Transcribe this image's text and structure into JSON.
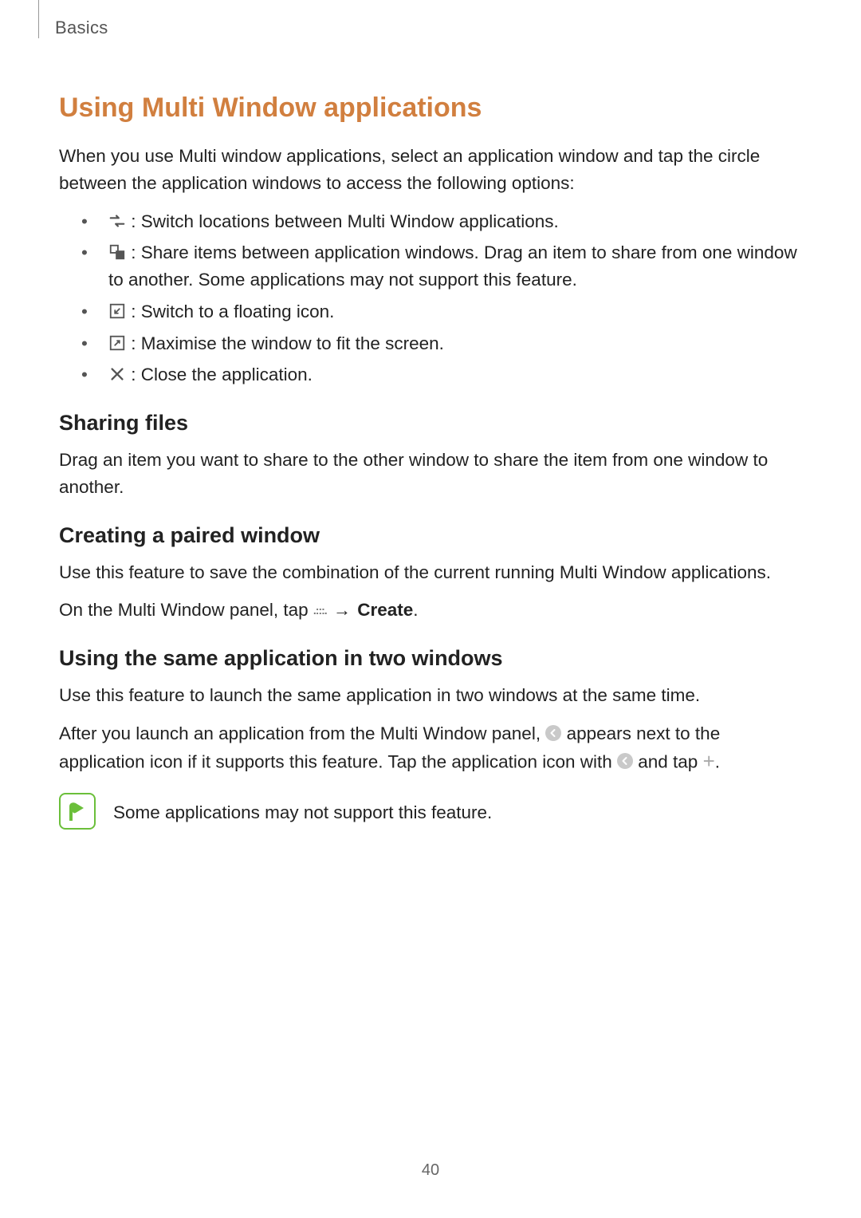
{
  "header": {
    "category": "Basics"
  },
  "title": "Using Multi Window applications",
  "intro": "When you use Multi window applications, select an application window and tap the circle between the application windows to access the following options:",
  "bullets": [
    {
      "text": ": Switch locations between Multi Window applications."
    },
    {
      "text": ": Share items between application windows. Drag an item to share from one window to another. Some applications may not support this feature."
    },
    {
      "text": ": Switch to a floating icon."
    },
    {
      "text": ": Maximise the window to fit the screen."
    },
    {
      "text": ": Close the application."
    }
  ],
  "sections": {
    "sharing": {
      "heading": "Sharing files",
      "body": "Drag an item you want to share to the other window to share the item from one window to another."
    },
    "paired": {
      "heading": "Creating a paired window",
      "body1": "Use this feature to save the combination of the current running Multi Window applications.",
      "body2a": "On the Multi Window panel, tap ",
      "body2b": "Create",
      "body2c": "."
    },
    "sameapp": {
      "heading": "Using the same application in two windows",
      "body1": "Use this feature to launch the same application in two windows at the same time.",
      "body2a": "After you launch an application from the Multi Window panel, ",
      "body2b": " appears next to the application icon if it supports this feature. Tap the application icon with ",
      "body2c": " and tap ",
      "body2d": "."
    }
  },
  "note": "Some applications may not support this feature.",
  "pageNumber": "40"
}
